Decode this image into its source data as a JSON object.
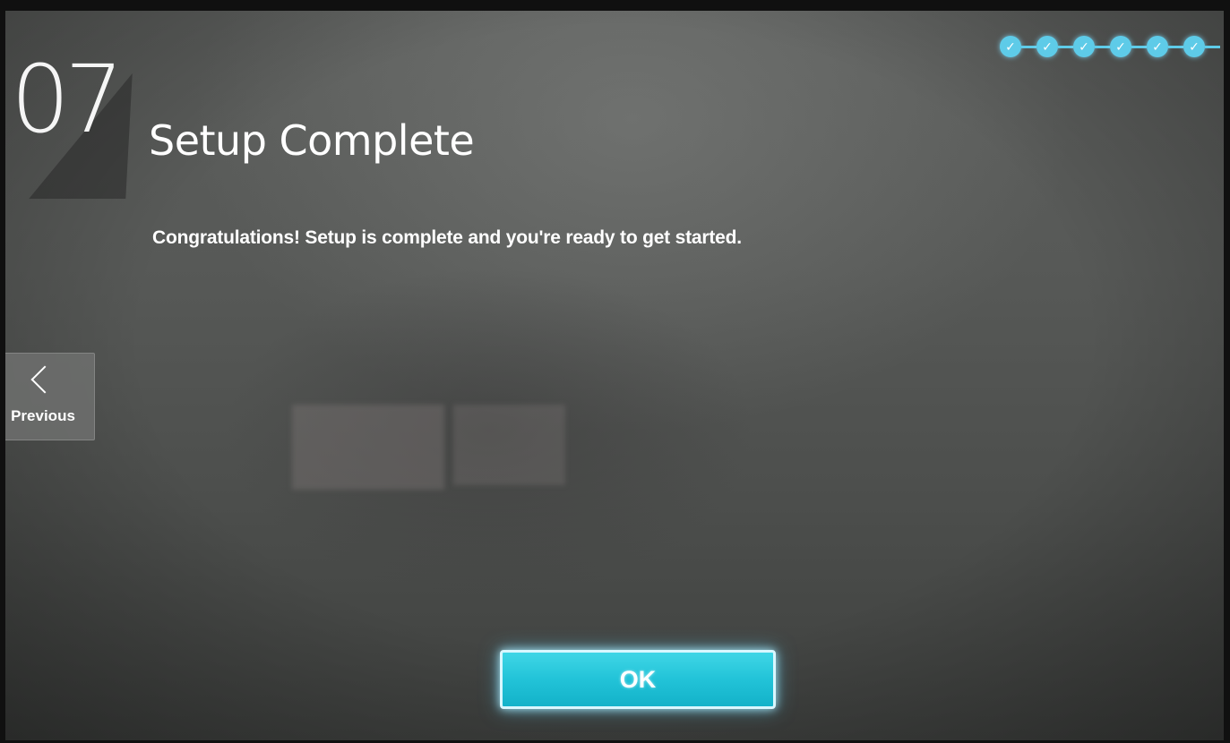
{
  "step": {
    "number": "07",
    "title": "Setup Complete",
    "message": "Congratulations! Setup is complete and you're ready to get started."
  },
  "progress": {
    "completed_steps": 6,
    "total_steps": 6,
    "icon": "check-icon",
    "color": "#5ecbe8"
  },
  "navigation": {
    "previous_label": "Previous",
    "previous_icon": "chevron-left-icon"
  },
  "actions": {
    "ok_label": "OK",
    "ok_color": "#22c3d8"
  }
}
